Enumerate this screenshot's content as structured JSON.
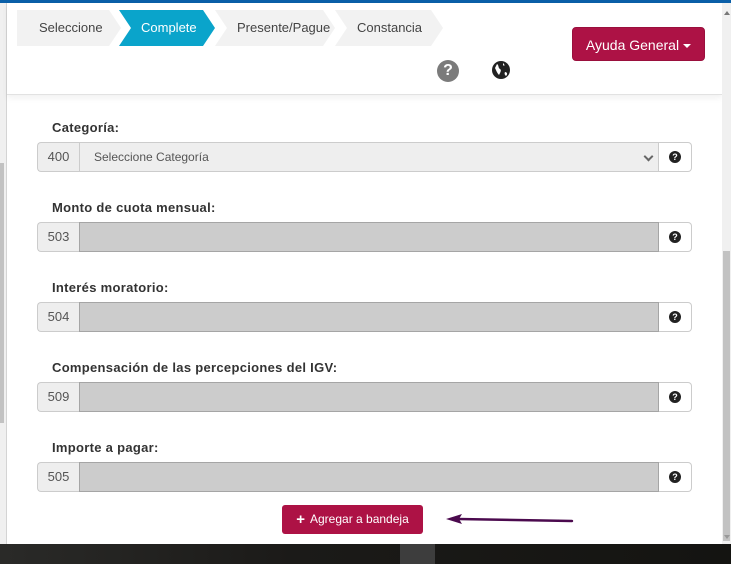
{
  "wizard": {
    "steps": [
      {
        "label": "Seleccione",
        "active": false
      },
      {
        "label": "Complete",
        "active": true
      },
      {
        "label": "Presente/Pague",
        "active": false
      },
      {
        "label": "Constancia",
        "active": false
      }
    ]
  },
  "header": {
    "help_icon": "question-circle-icon",
    "language_icon": "globe-icon",
    "ayuda_button": "Ayuda General"
  },
  "form": {
    "fields": [
      {
        "label": "Categoría:",
        "code": "400",
        "type": "select",
        "value": "Seleccione Categoría"
      },
      {
        "label": "Monto de cuota mensual:",
        "code": "503",
        "type": "input",
        "value": ""
      },
      {
        "label": "Interés moratorio:",
        "code": "504",
        "type": "input",
        "value": ""
      },
      {
        "label": "Compensación de las percepciones del IGV:",
        "code": "509",
        "type": "input",
        "value": ""
      },
      {
        "label": "Importe a pagar:",
        "code": "505",
        "type": "input",
        "value": ""
      }
    ],
    "help_glyph": "?",
    "submit_button": "Agregar a bandeja"
  },
  "colors": {
    "brand": "#ad1245",
    "active_step": "#0aa4cb",
    "arrow_annotation": "#4b0a4e"
  }
}
